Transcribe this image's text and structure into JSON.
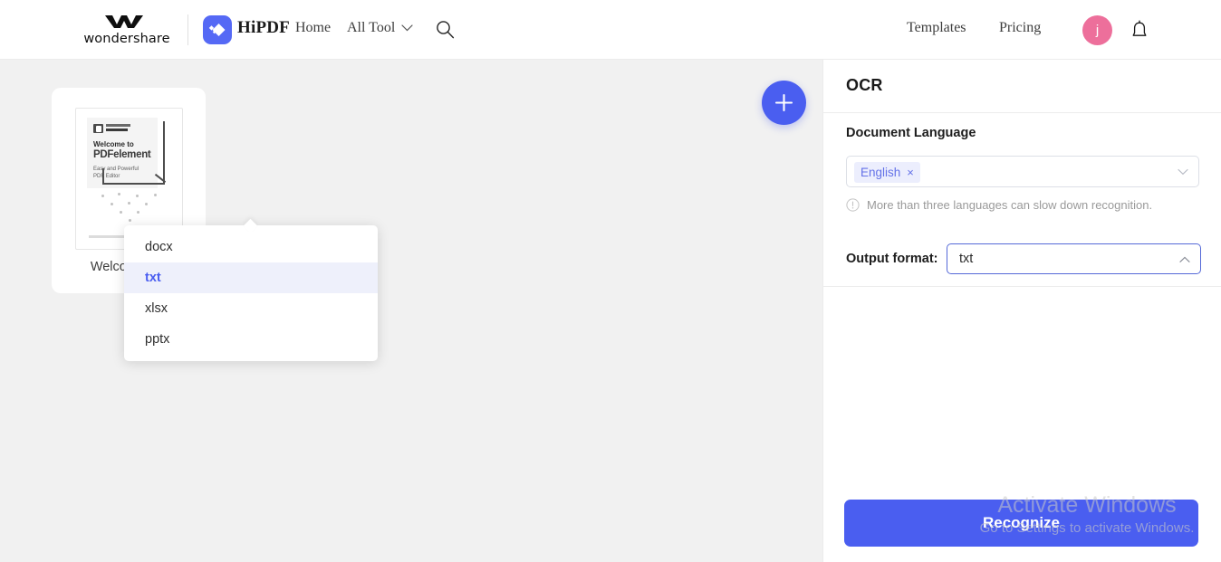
{
  "header": {
    "wondershare_wordmark": "wondershare",
    "product_name": "HiPDF",
    "nav": [
      {
        "label": "Home",
        "name": "nav-home"
      },
      {
        "label": "All Tool",
        "name": "nav-all-tool"
      }
    ],
    "right_nav": [
      {
        "label": "Templates",
        "name": "nav-templates"
      },
      {
        "label": "Pricing",
        "name": "nav-pricing"
      }
    ],
    "avatar_initial": "j",
    "avatar_color": "#ed6f9b",
    "icons": {
      "search": "search-icon",
      "chevron_down": "chevron-down-icon",
      "bell": "notification-bell-icon"
    }
  },
  "workspace": {
    "file": {
      "name": "Welcome.pdf",
      "thumbnail": {
        "brand": "Wondershare PDFelement",
        "heading": "Welcome to",
        "title": "PDFelement",
        "subtitle_line1": "Easy and Powerful",
        "subtitle_line2": "PDF Editor"
      }
    },
    "add_button_label": "+",
    "add_button_color": "#4a5ef0"
  },
  "panel": {
    "title": "OCR",
    "language": {
      "label": "Document Language",
      "selected_tags": [
        "English"
      ],
      "remove_symbol": "×",
      "hint": "More than three languages can slow down recognition.",
      "tag_text_color": "#6472e8",
      "tag_bg_color": "#eceefd"
    },
    "output_format": {
      "label": "Output format:",
      "value": "txt",
      "options": [
        {
          "label": "docx",
          "selected": false
        },
        {
          "label": "txt",
          "selected": true
        },
        {
          "label": "xlsx",
          "selected": false
        },
        {
          "label": "pptx",
          "selected": false
        }
      ],
      "accent_color": "#4a5ef0",
      "selected_bg_color": "#eef0fb"
    },
    "recognize_button": {
      "label": "Recognize",
      "color": "#4a5ef0"
    }
  },
  "watermark": {
    "title": "Activate Windows",
    "subtitle": "Go to Settings to activate Windows."
  }
}
